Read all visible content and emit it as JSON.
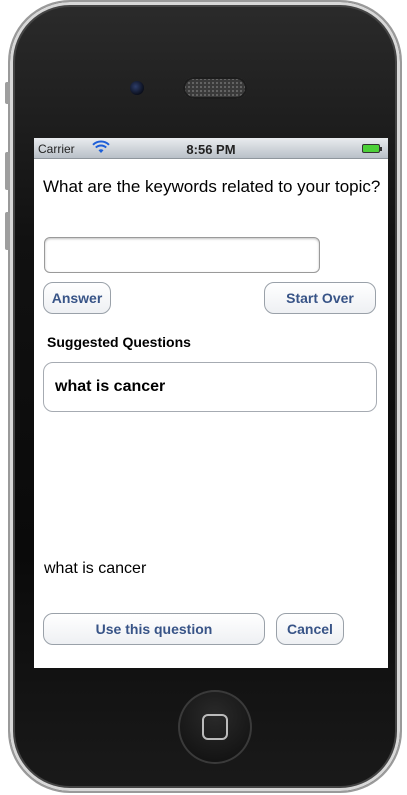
{
  "status_bar": {
    "carrier": "Carrier",
    "time": "8:56 PM",
    "wifi_icon": "wifi-icon",
    "battery_icon": "battery-icon",
    "battery_color": "#4cd038"
  },
  "form": {
    "prompt": "What are the keywords related to your topic?",
    "keywords_value": "",
    "answer_label": "Answer",
    "start_over_label": "Start Over"
  },
  "suggestions": {
    "title": "Suggested Questions",
    "items": [
      "what is cancer"
    ]
  },
  "selection": {
    "current_question": "what is cancer",
    "use_label": "Use this question",
    "cancel_label": "Cancel"
  },
  "colors": {
    "button_text": "#385487"
  }
}
